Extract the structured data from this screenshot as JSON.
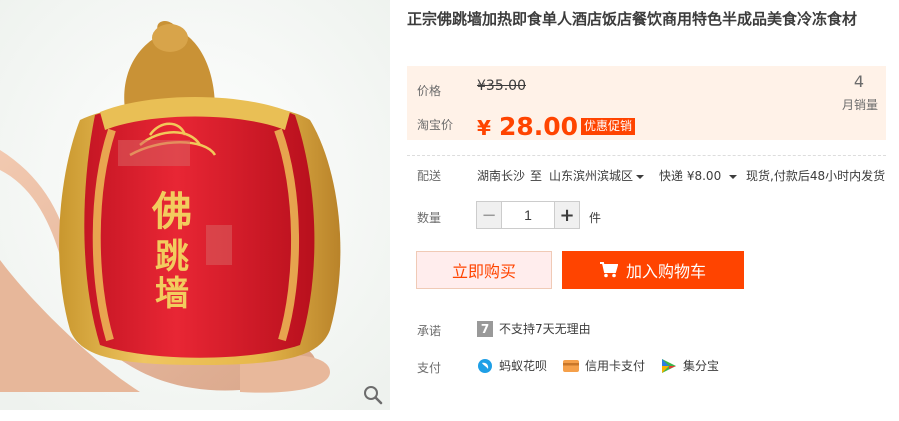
{
  "product": {
    "title": "正宗佛跳墙加热即食单人酒店饭店餐饮商用特色半成品美食冷冻食材",
    "image_text": "佛跳墙"
  },
  "price": {
    "label": "价格",
    "original": "¥35.00",
    "promo_label": "淘宝价",
    "currency": "¥",
    "current": "28.00",
    "badge": "优惠促销",
    "monthly_sales": "4",
    "monthly_sales_label": "月销量"
  },
  "delivery": {
    "label": "配送",
    "from": "湖南长沙",
    "to_word": "至",
    "destination": "山东滨州滨城区",
    "method": "快递",
    "fee": "¥8.00",
    "note": "现货,付款后48小时内发货"
  },
  "quantity": {
    "label": "数量",
    "value": "1",
    "unit": "件",
    "minus": "−",
    "plus": "+"
  },
  "buttons": {
    "buy_now": "立即购买",
    "add_to_cart": "加入购物车"
  },
  "promise": {
    "label": "承诺",
    "icon_text": "7",
    "text": "不支持7天无理由"
  },
  "payment": {
    "label": "支付",
    "methods": [
      "蚂蚁花呗",
      "信用卡支付",
      "集分宝"
    ]
  },
  "colors": {
    "accent": "#ff4400",
    "price_bg": "#fff2e8"
  }
}
